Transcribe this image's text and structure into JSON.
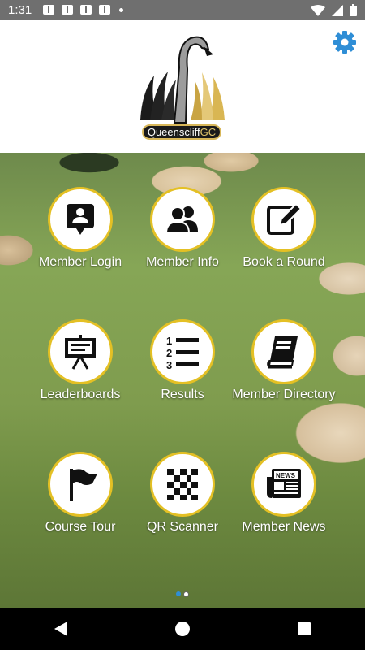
{
  "status_bar": {
    "time": "1:31"
  },
  "header": {
    "logo_text_main": "Queenscliff",
    "logo_text_accent": "GC"
  },
  "tiles": [
    {
      "label": "Member Login",
      "icon": "member-login-icon"
    },
    {
      "label": "Member Info",
      "icon": "members-icon"
    },
    {
      "label": "Book a Round",
      "icon": "edit-icon"
    },
    {
      "label": "Leaderboards",
      "icon": "presentation-board-icon"
    },
    {
      "label": "Results",
      "icon": "numbered-list-icon"
    },
    {
      "label": "Member Directory",
      "icon": "book-icon"
    },
    {
      "label": "Course Tour",
      "icon": "flag-icon"
    },
    {
      "label": "QR Scanner",
      "icon": "qr-code-icon"
    },
    {
      "label": "Member News",
      "icon": "newspaper-icon"
    }
  ],
  "news_icon_text": "NEWS",
  "colors": {
    "accent_ring": "#e4c024",
    "settings_blue": "#2f8ed6",
    "status_bar": "#6f6f6f"
  }
}
